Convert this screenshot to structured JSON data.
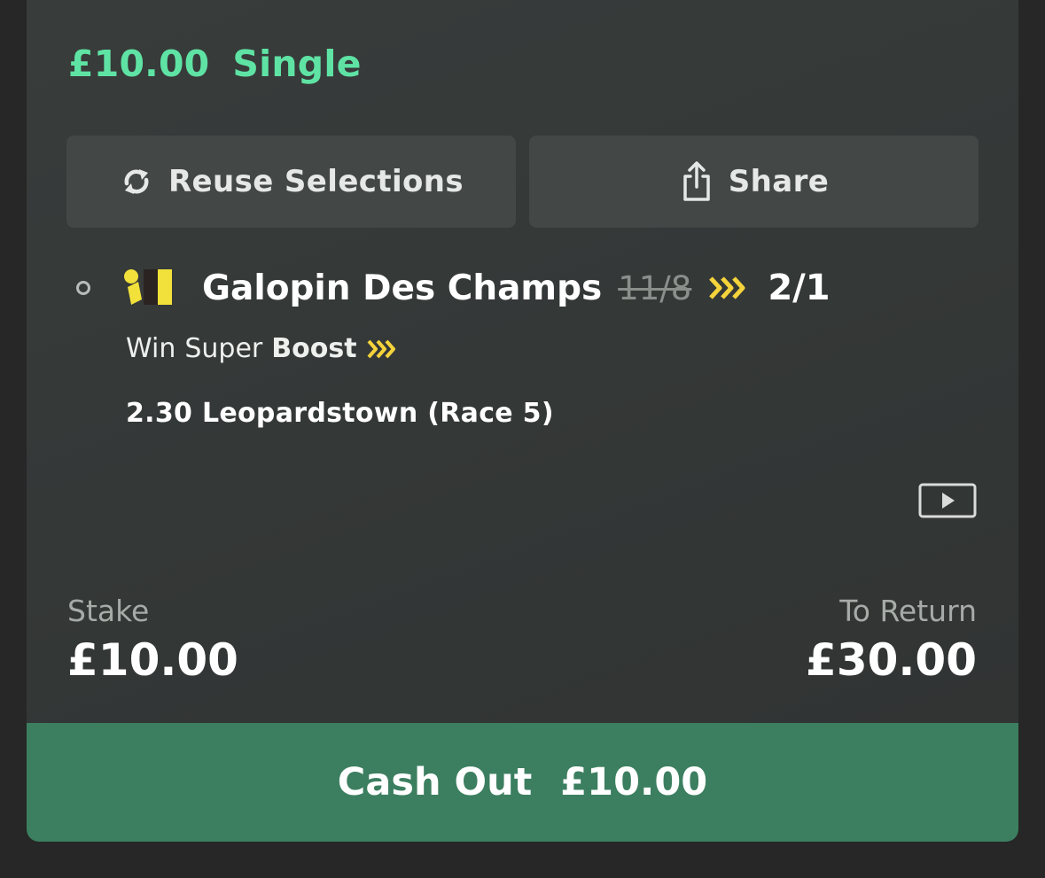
{
  "bet": {
    "stake_header": "£10.00",
    "bet_type": "Single"
  },
  "actions": {
    "reuse_label": "Reuse Selections",
    "share_label": "Share"
  },
  "selection": {
    "runner": "Galopin Des Champs",
    "original_price": "11/8",
    "boosted_price": "2/1",
    "market": "Win",
    "promo_prefix": "Super",
    "promo_word": "Boost",
    "event": "2.30 Leopardstown (Race 5)",
    "icons": [
      "radio-icon",
      "silks-icon",
      "boost-chevrons-icon",
      "play-video-icon"
    ]
  },
  "summary": {
    "stake_label": "Stake",
    "stake_value": "£10.00",
    "return_label": "To Return",
    "return_value": "£30.00"
  },
  "cashout": {
    "label": "Cash Out",
    "amount": "£10.00"
  },
  "colors": {
    "accent_green": "#5fe3a4",
    "cashout_green": "#3c7f60",
    "boost_yellow": "#f5d33b"
  }
}
